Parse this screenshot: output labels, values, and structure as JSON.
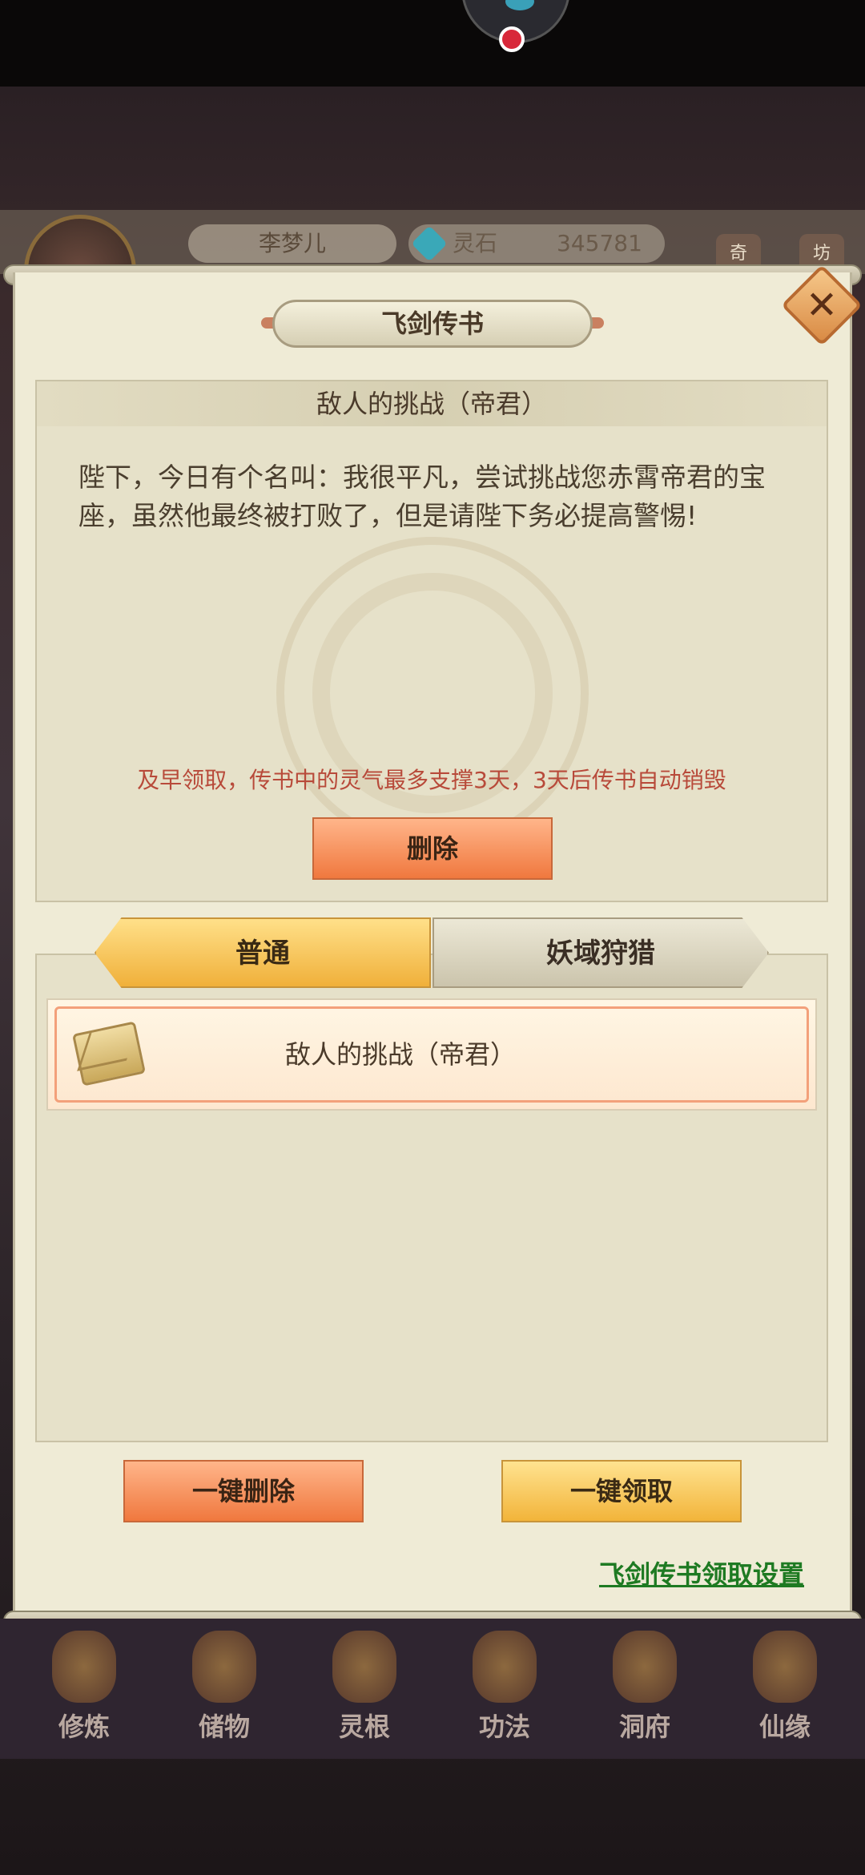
{
  "hud": {
    "player_name": "李梦儿",
    "currency_label": "灵石",
    "currency_value": "345781",
    "tag_1": "奇",
    "tag_2": "坊"
  },
  "dialog": {
    "title": "飞剑传书",
    "close_icon": "close-icon",
    "message": {
      "heading": "敌人的挑战（帝君）",
      "body": "陛下，今日有个名叫：我很平凡，尝试挑战您赤霄帝君的宝座，虽然他最终被打败了，但是请陛下务必提高警惕!",
      "warning": "及早领取，传书中的灵气最多支撑3天，3天后传书自动销毁",
      "delete_label": "删除"
    },
    "tabs": [
      {
        "label": "普通",
        "active": true
      },
      {
        "label": "妖域狩猎",
        "active": false
      }
    ],
    "list": [
      {
        "title": "敌人的挑战（帝君）",
        "icon": "envelope-icon"
      }
    ],
    "delete_all_label": "一键删除",
    "claim_all_label": "一键领取",
    "settings_link": "飞剑传书领取设置"
  },
  "bottom_nav": [
    {
      "label": "修炼"
    },
    {
      "label": "储物"
    },
    {
      "label": "灵根"
    },
    {
      "label": "功法"
    },
    {
      "label": "洞府"
    },
    {
      "label": "仙缘"
    }
  ],
  "colors": {
    "accent_orange": "#f0783e",
    "accent_gold": "#f2b43a",
    "warning_red": "#b84a3a",
    "link_green": "#1e7a22",
    "panel_bg": "#efebd6"
  }
}
